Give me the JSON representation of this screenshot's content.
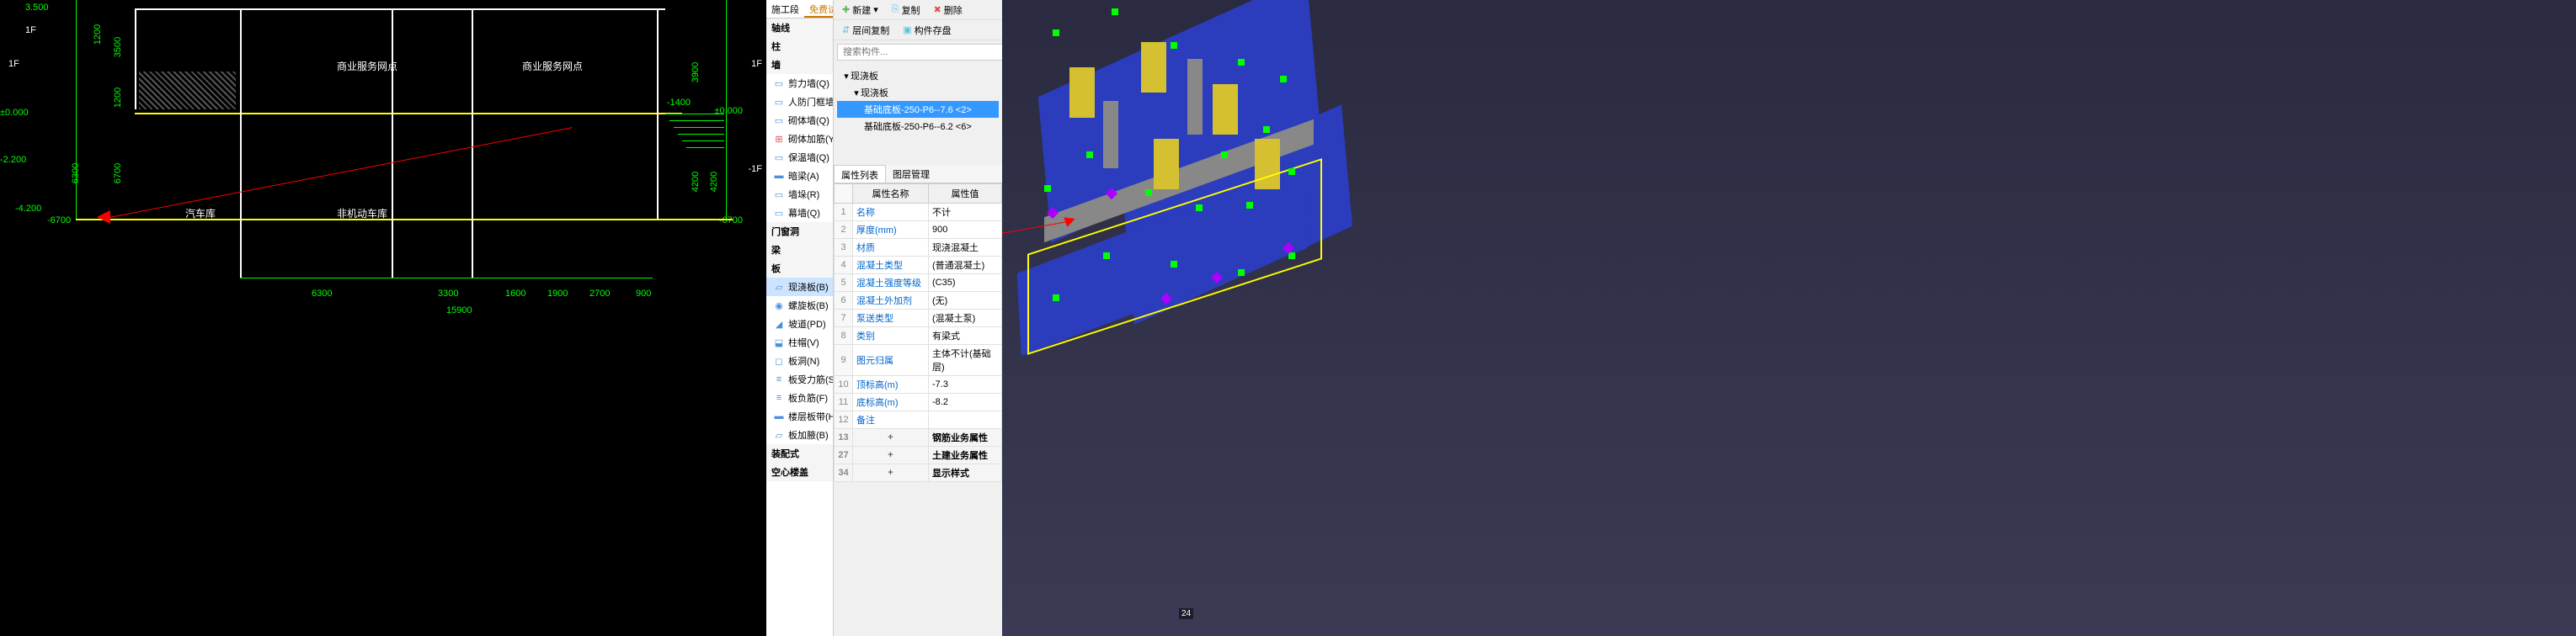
{
  "cad": {
    "floors_left": [
      "3.500",
      "1F",
      "1F",
      "±0.000",
      "-2.200",
      "-4.200"
    ],
    "labels": {
      "commercial1": "商业服务网点",
      "commercial2": "商业服务网点",
      "garage": "汽车库",
      "nonmotor": "非机动车库"
    },
    "level_right": [
      "1F",
      "-1F"
    ],
    "dims_left": [
      "1200",
      "3500",
      "6300",
      "1200",
      "6700",
      "-6700"
    ],
    "dims_right": [
      "3900",
      "4200",
      "4200",
      "-1400",
      "±0.000"
    ],
    "dims_bottom": [
      "6300",
      "3300",
      "1600",
      "1900",
      "2700",
      "900",
      "15900"
    ]
  },
  "tabs": {
    "t1": "施工段",
    "t2": "免费试用"
  },
  "categories": {
    "axis": "轴线",
    "column": "柱",
    "wall": "墙",
    "items_wall": [
      {
        "label": "剪力墙(Q)",
        "key": "shear-wall"
      },
      {
        "label": "人防门框墙(R)",
        "key": "defense-wall"
      },
      {
        "label": "砌体墙(Q)",
        "key": "masonry-wall"
      },
      {
        "label": "砌体加筋(Y)",
        "key": "masonry-rebar"
      },
      {
        "label": "保温墙(Q)",
        "key": "insulation-wall"
      },
      {
        "label": "暗梁(A)",
        "key": "hidden-beam"
      },
      {
        "label": "墙垛(R)",
        "key": "wall-stack"
      },
      {
        "label": "幕墙(Q)",
        "key": "curtain-wall"
      }
    ],
    "door": "门窗洞",
    "beam": "梁",
    "slab": "板",
    "items_slab": [
      {
        "label": "现浇板(B)",
        "key": "cast-slab",
        "selected": true
      },
      {
        "label": "螺旋板(B)",
        "key": "spiral-slab"
      },
      {
        "label": "坡道(PD)",
        "key": "ramp"
      },
      {
        "label": "柱帽(V)",
        "key": "cap"
      },
      {
        "label": "板洞(N)",
        "key": "slab-hole"
      },
      {
        "label": "板受力筋(S)",
        "key": "slab-rebar"
      },
      {
        "label": "板负筋(F)",
        "key": "slab-neg"
      },
      {
        "label": "楼层板带(H)",
        "key": "floor-strip"
      },
      {
        "label": "板加腋(B)",
        "key": "slab-haunch"
      }
    ],
    "assembly": "装配式",
    "hollow": "空心楼盖"
  },
  "toolbar": {
    "new": "新建",
    "copy": "复制",
    "delete": "删除",
    "interlayer": "层间复制",
    "archive": "构件存盘"
  },
  "search": {
    "placeholder": "搜索构件..."
  },
  "tree": {
    "root": "现浇板",
    "child": "现浇板",
    "leaf1": "基础底板-250-P6--7.6 <2>",
    "leaf2": "基础底板-250-P6--6.2 <6>"
  },
  "prop_tabs": {
    "t1": "属性列表",
    "t2": "图层管理"
  },
  "prop_headers": {
    "name": "属性名称",
    "value": "属性值"
  },
  "props": [
    {
      "idx": "1",
      "name": "名称",
      "value": "不计"
    },
    {
      "idx": "2",
      "name": "厚度(mm)",
      "value": "900"
    },
    {
      "idx": "3",
      "name": "材质",
      "value": "现浇混凝土"
    },
    {
      "idx": "4",
      "name": "混凝土类型",
      "value": "(普通混凝土)"
    },
    {
      "idx": "5",
      "name": "混凝土强度等级",
      "value": "(C35)"
    },
    {
      "idx": "6",
      "name": "混凝土外加剂",
      "value": "(无)"
    },
    {
      "idx": "7",
      "name": "泵送类型",
      "value": "(混凝土泵)"
    },
    {
      "idx": "8",
      "name": "类别",
      "value": "有梁式"
    },
    {
      "idx": "9",
      "name": "图元归属",
      "value": "主体不计(基础层)"
    },
    {
      "idx": "10",
      "name": "顶标高(m)",
      "value": "-7.3"
    },
    {
      "idx": "11",
      "name": "底标高(m)",
      "value": "-8.2"
    },
    {
      "idx": "12",
      "name": "备注",
      "value": ""
    }
  ],
  "prop_groups": [
    {
      "idx": "13",
      "name": "钢筋业务属性"
    },
    {
      "idx": "27",
      "name": "土建业务属性"
    },
    {
      "idx": "34",
      "name": "显示样式"
    }
  ],
  "viewport": {
    "axis_label": "24"
  }
}
